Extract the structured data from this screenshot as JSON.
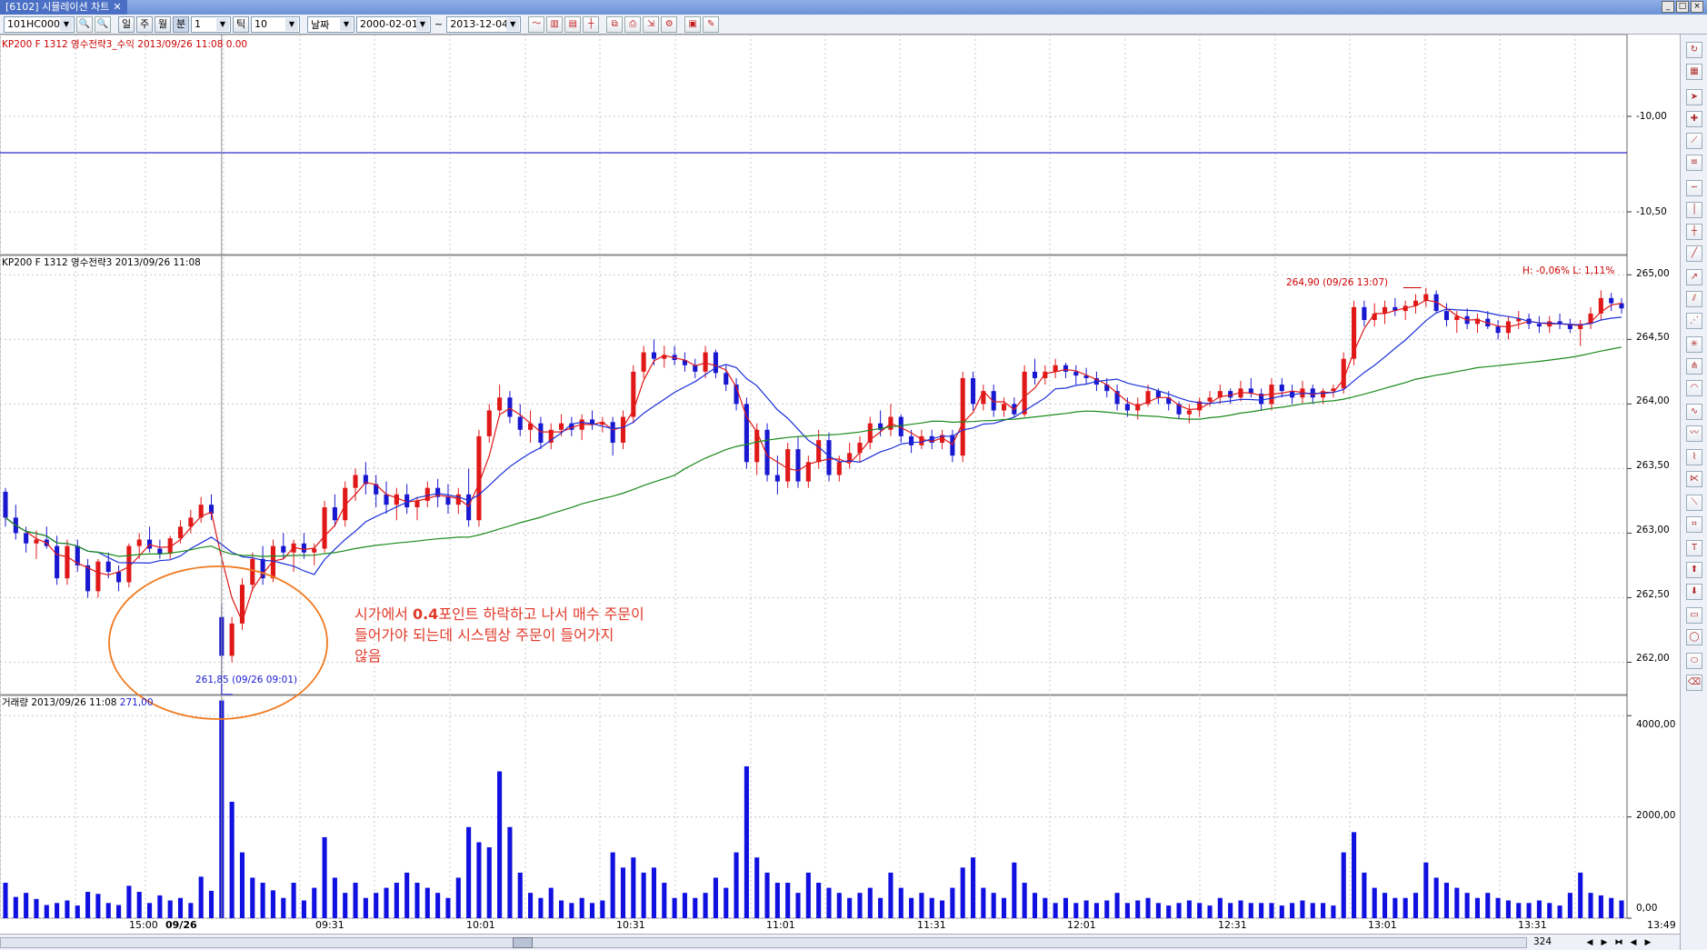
{
  "window": {
    "title": "[6102] 시뮬레이션 차트",
    "close_glyph": "✕"
  },
  "toolbar": {
    "code": "101HC000",
    "period_buttons": [
      "일",
      "주",
      "월",
      "분"
    ],
    "period_value": "1",
    "tick_label": "틱",
    "tick_value": "10",
    "date_mode": "날짜",
    "start_date": "2000-02-01",
    "range_sep": "~",
    "end_date": "2013-12-04"
  },
  "top_pane": {
    "label": "KP200 F 1312  영수전략3_수익 2013/09/26 11:08",
    "value": "0.00",
    "y_ticks": [
      "-10,00",
      "-10,50"
    ]
  },
  "price_pane": {
    "label": "KP200 F 1312  영수전략3  2013/09/26 11:08",
    "hl": "H: -0,06%    L: 1,11%",
    "high_note": "264,90 (09/26 13:07)",
    "low_note": "261,85 (09/26 09:01)",
    "y_ticks": [
      "265,00",
      "264,50",
      "264,00",
      "263,50",
      "263,00",
      "262,50",
      "262,00"
    ]
  },
  "volume_pane": {
    "label": "거래량  2013/09/26 11:08",
    "value": "271,00",
    "y_ticks": [
      "4000,00",
      "2000,00",
      "0,00"
    ]
  },
  "x_axis": {
    "labels": [
      "15:00",
      "09/26",
      "09:31",
      "10:01",
      "10:31",
      "11:01",
      "11:31",
      "12:01",
      "12:31",
      "13:01",
      "13:31"
    ],
    "end_time": "13:49"
  },
  "annotation": {
    "line1_a": "시가에서 ",
    "line1_bold": "0.4",
    "line1_b": "포인트 하락하고 나서 매수 주문이",
    "line2": "들어가야 되는데 시스템상 주문이 들어가지",
    "line3": "않음"
  },
  "status": {
    "bar_count": "324"
  },
  "colors": {
    "up_candle": "#e01818",
    "down_candle": "#1818d0",
    "ma_short": "#e01818",
    "ma_mid": "#1a2fd8",
    "ma_long": "#1a8a1a",
    "volume": "#1010e0",
    "annotation": "#e03a2a",
    "ellipse": "#f07a20"
  },
  "chart_data": {
    "type": "candlestick",
    "title": "KP200 F 1312  영수전략3",
    "y_range": [
      261.75,
      265.15
    ],
    "volume_range": [
      0,
      4400
    ],
    "high": 264.9,
    "low": 261.85,
    "candles": [
      [
        263.32,
        263.35,
        263.05,
        263.12,
        700
      ],
      [
        263.12,
        263.22,
        262.95,
        263.0,
        420
      ],
      [
        263.0,
        263.05,
        262.85,
        262.92,
        500
      ],
      [
        262.92,
        263.02,
        262.8,
        262.95,
        380
      ],
      [
        262.95,
        263.05,
        262.88,
        262.9,
        260
      ],
      [
        262.9,
        262.98,
        262.6,
        262.65,
        300
      ],
      [
        262.65,
        262.95,
        262.6,
        262.9,
        350
      ],
      [
        262.9,
        262.95,
        262.7,
        262.75,
        250
      ],
      [
        262.75,
        262.8,
        262.5,
        262.55,
        520
      ],
      [
        262.55,
        262.8,
        262.5,
        262.78,
        480
      ],
      [
        262.78,
        262.85,
        262.65,
        262.7,
        300
      ],
      [
        262.7,
        262.75,
        262.55,
        262.62,
        260
      ],
      [
        262.62,
        262.92,
        262.58,
        262.9,
        640
      ],
      [
        262.9,
        263.0,
        262.8,
        262.95,
        520
      ],
      [
        262.95,
        263.05,
        262.85,
        262.88,
        300
      ],
      [
        262.88,
        262.95,
        262.8,
        262.84,
        450
      ],
      [
        262.84,
        262.98,
        262.8,
        262.96,
        350
      ],
      [
        262.96,
        263.1,
        262.92,
        263.05,
        400
      ],
      [
        263.05,
        263.18,
        263.0,
        263.12,
        300
      ],
      [
        263.12,
        263.28,
        263.08,
        263.22,
        820
      ],
      [
        263.22,
        263.3,
        263.1,
        263.15,
        540
      ],
      [
        262.35,
        262.45,
        261.85,
        262.05,
        4300
      ],
      [
        262.05,
        262.35,
        262.0,
        262.3,
        2300
      ],
      [
        262.3,
        262.65,
        262.25,
        262.6,
        1300
      ],
      [
        262.6,
        262.85,
        262.55,
        262.8,
        800
      ],
      [
        262.8,
        262.9,
        262.6,
        262.65,
        700
      ],
      [
        262.65,
        262.95,
        262.62,
        262.9,
        550
      ],
      [
        262.9,
        263.0,
        262.8,
        262.85,
        400
      ],
      [
        262.85,
        262.95,
        262.7,
        262.92,
        700
      ],
      [
        262.92,
        263.0,
        262.8,
        262.85,
        350
      ],
      [
        262.85,
        262.92,
        262.75,
        262.88,
        600
      ],
      [
        262.88,
        263.25,
        262.85,
        263.2,
        1600
      ],
      [
        263.2,
        263.3,
        263.05,
        263.1,
        800
      ],
      [
        263.1,
        263.4,
        263.05,
        263.35,
        500
      ],
      [
        263.35,
        263.5,
        263.25,
        263.45,
        700
      ],
      [
        263.45,
        263.55,
        263.3,
        263.38,
        400
      ],
      [
        263.38,
        263.45,
        263.2,
        263.3,
        500
      ],
      [
        263.3,
        263.4,
        263.15,
        263.22,
        600
      ],
      [
        263.22,
        263.35,
        263.1,
        263.3,
        700
      ],
      [
        263.3,
        263.38,
        263.15,
        263.2,
        900
      ],
      [
        263.2,
        263.28,
        263.1,
        263.25,
        700
      ],
      [
        263.25,
        263.4,
        263.2,
        263.35,
        600
      ],
      [
        263.35,
        263.42,
        263.2,
        263.28,
        500
      ],
      [
        263.28,
        263.38,
        263.15,
        263.22,
        400
      ],
      [
        263.22,
        263.35,
        263.15,
        263.3,
        800
      ],
      [
        263.3,
        263.5,
        263.05,
        263.1,
        1800
      ],
      [
        263.1,
        263.8,
        263.05,
        263.75,
        1500
      ],
      [
        263.75,
        264.0,
        263.7,
        263.95,
        1400
      ],
      [
        263.95,
        264.15,
        263.9,
        264.05,
        2900
      ],
      [
        264.05,
        264.1,
        263.85,
        263.9,
        1800
      ],
      [
        263.9,
        264.0,
        263.75,
        263.8,
        900
      ],
      [
        263.8,
        263.95,
        263.7,
        263.85,
        500
      ],
      [
        263.85,
        263.9,
        263.65,
        263.7,
        400
      ],
      [
        263.7,
        263.85,
        263.65,
        263.8,
        600
      ],
      [
        263.8,
        263.92,
        263.75,
        263.85,
        350
      ],
      [
        263.85,
        263.9,
        263.75,
        263.8,
        300
      ],
      [
        263.8,
        263.92,
        263.72,
        263.88,
        400
      ],
      [
        263.88,
        263.95,
        263.8,
        263.84,
        300
      ],
      [
        263.84,
        263.9,
        263.78,
        263.86,
        350
      ],
      [
        263.86,
        263.9,
        263.6,
        263.7,
        1300
      ],
      [
        263.7,
        263.95,
        263.65,
        263.9,
        1000
      ],
      [
        263.9,
        264.3,
        263.85,
        264.25,
        1200
      ],
      [
        264.25,
        264.45,
        264.2,
        264.4,
        900
      ],
      [
        264.4,
        264.5,
        264.3,
        264.35,
        1000
      ],
      [
        264.35,
        264.45,
        264.28,
        264.38,
        700
      ],
      [
        264.38,
        264.45,
        264.3,
        264.34,
        400
      ],
      [
        264.34,
        264.4,
        264.25,
        264.3,
        500
      ],
      [
        264.3,
        264.35,
        264.2,
        264.25,
        400
      ],
      [
        264.25,
        264.45,
        264.2,
        264.4,
        500
      ],
      [
        264.4,
        264.42,
        264.2,
        264.24,
        800
      ],
      [
        264.24,
        264.3,
        264.1,
        264.15,
        600
      ],
      [
        264.15,
        264.2,
        263.95,
        264.0,
        1300
      ],
      [
        264.0,
        264.05,
        263.5,
        263.55,
        3000
      ],
      [
        263.55,
        263.85,
        263.45,
        263.8,
        1200
      ],
      [
        263.8,
        263.85,
        263.4,
        263.45,
        900
      ],
      [
        263.45,
        263.6,
        263.3,
        263.4,
        700
      ],
      [
        263.4,
        263.7,
        263.35,
        263.65,
        700
      ],
      [
        263.65,
        263.75,
        263.35,
        263.4,
        500
      ],
      [
        263.4,
        263.6,
        263.35,
        263.55,
        900
      ],
      [
        263.55,
        263.8,
        263.5,
        263.72,
        700
      ],
      [
        263.72,
        263.78,
        263.4,
        263.45,
        600
      ],
      [
        263.45,
        263.6,
        263.4,
        263.55,
        500
      ],
      [
        263.55,
        263.7,
        263.5,
        263.62,
        400
      ],
      [
        263.62,
        263.75,
        263.55,
        263.7,
        500
      ],
      [
        263.7,
        263.9,
        263.65,
        263.85,
        600
      ],
      [
        263.85,
        263.95,
        263.75,
        263.8,
        400
      ],
      [
        263.8,
        264.0,
        263.75,
        263.9,
        900
      ],
      [
        263.9,
        263.92,
        263.7,
        263.75,
        600
      ],
      [
        263.75,
        263.8,
        263.62,
        263.68,
        400
      ],
      [
        263.68,
        263.8,
        263.65,
        263.75,
        500
      ],
      [
        263.75,
        263.8,
        263.65,
        263.7,
        400
      ],
      [
        263.7,
        263.8,
        263.65,
        263.76,
        350
      ],
      [
        263.76,
        263.8,
        263.55,
        263.6,
        600
      ],
      [
        263.6,
        264.25,
        263.55,
        264.2,
        1000
      ],
      [
        264.2,
        264.25,
        263.95,
        264.0,
        1200
      ],
      [
        264.0,
        264.15,
        263.95,
        264.1,
        600
      ],
      [
        264.1,
        264.15,
        263.9,
        263.95,
        500
      ],
      [
        263.95,
        264.05,
        263.9,
        264.0,
        400
      ],
      [
        264.0,
        264.05,
        263.9,
        263.92,
        1100
      ],
      [
        263.92,
        264.3,
        263.9,
        264.25,
        700
      ],
      [
        264.25,
        264.35,
        264.15,
        264.2,
        500
      ],
      [
        264.2,
        264.3,
        264.15,
        264.25,
        400
      ],
      [
        264.25,
        264.35,
        264.2,
        264.3,
        300
      ],
      [
        264.3,
        264.32,
        264.2,
        264.25,
        400
      ],
      [
        264.25,
        264.3,
        264.15,
        264.22,
        300
      ],
      [
        264.22,
        264.28,
        264.15,
        264.2,
        350
      ],
      [
        264.2,
        264.25,
        264.1,
        264.15,
        300
      ],
      [
        264.15,
        264.2,
        264.05,
        264.1,
        350
      ],
      [
        264.1,
        264.15,
        263.95,
        264.0,
        500
      ],
      [
        264.0,
        264.05,
        263.9,
        263.95,
        300
      ],
      [
        263.95,
        264.05,
        263.88,
        264.0,
        350
      ],
      [
        264.0,
        264.15,
        263.98,
        264.1,
        400
      ],
      [
        264.1,
        264.12,
        264.0,
        264.05,
        300
      ],
      [
        264.05,
        264.1,
        263.95,
        264.0,
        250
      ],
      [
        264.0,
        264.02,
        263.88,
        263.92,
        300
      ],
      [
        263.92,
        264.0,
        263.85,
        263.95,
        350
      ],
      [
        263.95,
        264.05,
        263.9,
        264.02,
        300
      ],
      [
        264.02,
        264.1,
        263.98,
        264.05,
        250
      ],
      [
        264.05,
        264.15,
        264.0,
        264.1,
        400
      ],
      [
        264.1,
        264.12,
        264.0,
        264.05,
        300
      ],
      [
        264.05,
        264.18,
        264.02,
        264.12,
        350
      ],
      [
        264.12,
        264.2,
        264.05,
        264.08,
        300
      ],
      [
        264.08,
        264.12,
        263.95,
        264.0,
        300
      ],
      [
        264.0,
        264.2,
        263.95,
        264.15,
        300
      ],
      [
        264.15,
        264.2,
        264.05,
        264.1,
        250
      ],
      [
        264.1,
        264.15,
        264.0,
        264.05,
        300
      ],
      [
        264.05,
        264.18,
        264.0,
        264.12,
        350
      ],
      [
        264.12,
        264.15,
        264.0,
        264.05,
        300
      ],
      [
        264.05,
        264.12,
        264.0,
        264.1,
        300
      ],
      [
        264.1,
        264.15,
        264.05,
        264.12,
        250
      ],
      [
        264.12,
        264.4,
        264.08,
        264.35,
        1300
      ],
      [
        264.35,
        264.8,
        264.3,
        264.75,
        1700
      ],
      [
        264.75,
        264.8,
        264.6,
        264.65,
        900
      ],
      [
        264.65,
        264.78,
        264.6,
        264.7,
        600
      ],
      [
        264.7,
        264.8,
        264.62,
        264.75,
        500
      ],
      [
        264.75,
        264.82,
        264.68,
        264.72,
        400
      ],
      [
        264.72,
        264.8,
        264.65,
        264.76,
        400
      ],
      [
        264.76,
        264.85,
        264.7,
        264.8,
        500
      ],
      [
        264.8,
        264.9,
        264.75,
        264.85,
        1100
      ],
      [
        264.85,
        264.88,
        264.7,
        264.72,
        800
      ],
      [
        264.72,
        264.78,
        264.6,
        264.65,
        700
      ],
      [
        264.65,
        264.72,
        264.55,
        264.68,
        600
      ],
      [
        264.68,
        264.74,
        264.58,
        264.62,
        500
      ],
      [
        264.62,
        264.7,
        264.55,
        264.66,
        400
      ],
      [
        264.66,
        264.72,
        264.58,
        264.6,
        500
      ],
      [
        264.6,
        264.65,
        264.5,
        264.55,
        400
      ],
      [
        264.55,
        264.68,
        264.5,
        264.64,
        350
      ],
      [
        264.64,
        264.72,
        264.58,
        264.66,
        300
      ],
      [
        264.66,
        264.7,
        264.58,
        264.62,
        300
      ],
      [
        264.62,
        264.68,
        264.55,
        264.6,
        350
      ],
      [
        264.6,
        264.68,
        264.55,
        264.64,
        300
      ],
      [
        264.64,
        264.7,
        264.58,
        264.62,
        250
      ],
      [
        264.62,
        264.66,
        264.55,
        264.58,
        500
      ],
      [
        264.58,
        264.65,
        264.45,
        264.62,
        900
      ],
      [
        264.62,
        264.75,
        264.58,
        264.7,
        500
      ],
      [
        264.7,
        264.88,
        264.65,
        264.82,
        450
      ],
      [
        264.82,
        264.86,
        264.72,
        264.78,
        400
      ],
      [
        264.78,
        264.82,
        264.7,
        264.74,
        350
      ]
    ]
  }
}
